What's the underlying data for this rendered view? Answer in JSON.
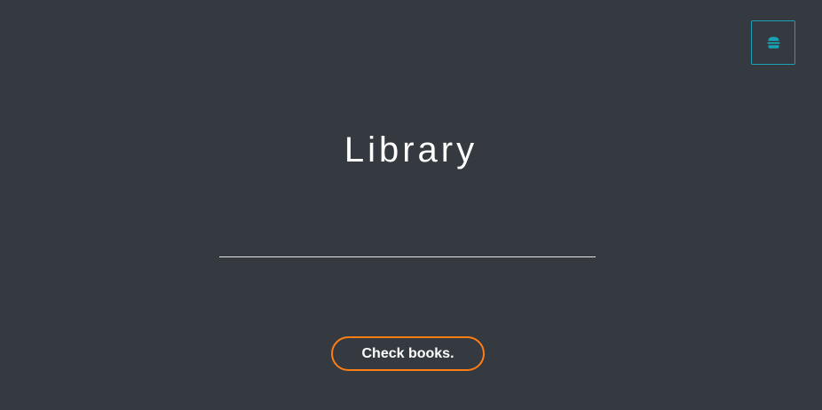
{
  "header": {
    "menu_icon": "burger-icon",
    "accent_color": "#17a2b8"
  },
  "hero": {
    "title": "Library"
  },
  "cta": {
    "label": "Check books.",
    "border_color": "#fd7e14"
  },
  "theme": {
    "background": "#343a40",
    "text": "#ffffff"
  }
}
